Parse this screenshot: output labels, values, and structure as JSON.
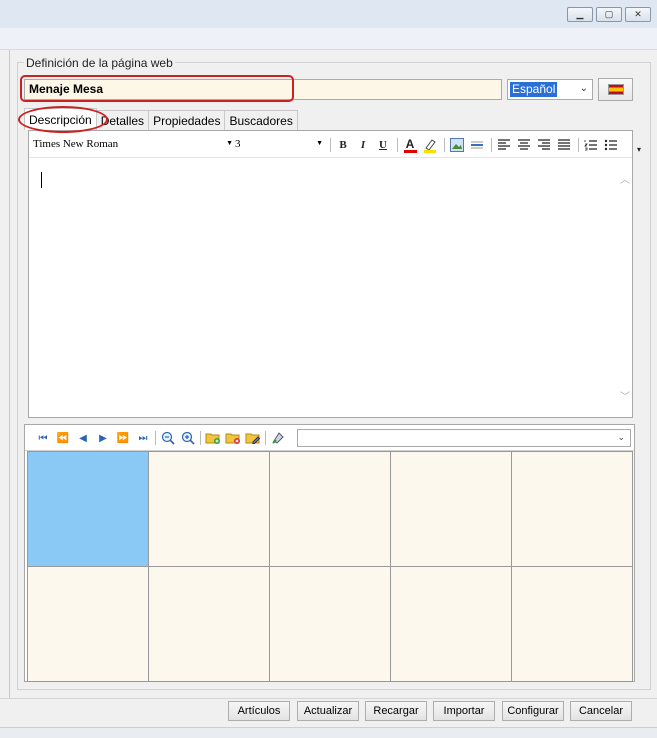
{
  "window": {
    "controls": {
      "minimize_icon": "minimize-icon",
      "restore_icon": "restore-icon",
      "close_icon": "close-icon"
    }
  },
  "group": {
    "title": "Definición de la página web"
  },
  "name_field": {
    "value": "Menaje Mesa"
  },
  "language": {
    "selected": "Español",
    "flag_icon": "spain-flag-icon"
  },
  "tabs": [
    {
      "label": "Descripción",
      "active": true
    },
    {
      "label": "Detalles",
      "active": false
    },
    {
      "label": "Propiedades",
      "active": false
    },
    {
      "label": "Buscadores",
      "active": false
    }
  ],
  "editor": {
    "font_family": "Times New Roman",
    "font_size": "3",
    "toolbar": {
      "bold": "B",
      "italic": "I",
      "underline": "U",
      "font_color": "A"
    },
    "content": ""
  },
  "image_grid": {
    "selected_index": 0,
    "cell_count": 10,
    "filter_value": ""
  },
  "buttons": {
    "articulos": "Artículos",
    "actualizar": "Actualizar",
    "recargar": "Recargar",
    "importar": "Importar",
    "configurar": "Configurar",
    "cancelar": "Cancelar"
  },
  "colors": {
    "selected_cell": "#8ac8f5",
    "input_bg": "#fdf7e8",
    "highlight_ring": "#cc2222"
  }
}
